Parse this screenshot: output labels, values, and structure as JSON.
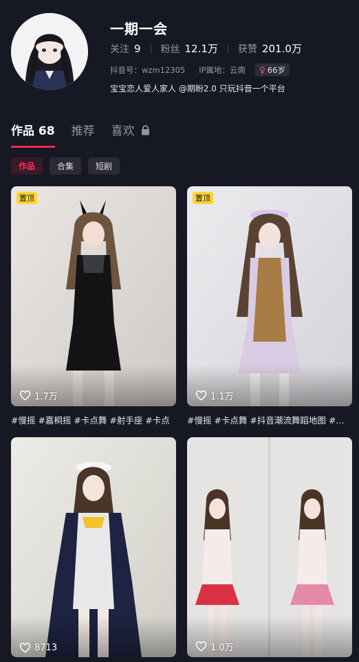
{
  "profile": {
    "name": "一期一会",
    "stats": [
      {
        "label": "关注",
        "value": "9"
      },
      {
        "label": "粉丝",
        "value": "12.1万"
      },
      {
        "label": "获赞",
        "value": "201.0万"
      }
    ],
    "douyin_id": "抖音号：wzm12305",
    "ip_location": "IP属地：云南",
    "age": "66岁",
    "bio": "宝宝恋人爱人家人 @期盼2.0 只玩抖音一个平台"
  },
  "tabs": [
    {
      "label": "作品",
      "count": "68"
    },
    {
      "label": "推荐"
    },
    {
      "label": "喜欢"
    }
  ],
  "chips": [
    "作品",
    "合集",
    "短剧"
  ],
  "videos": [
    {
      "pinned_label": "置顶",
      "likes": "1.7万",
      "caption": "#慢摇 #嘉桐摇 #卡点舞 #射手座 #卡点"
    },
    {
      "pinned_label": "置顶",
      "likes": "1.1万",
      "caption": "#慢摇 #卡点舞 #抖音潮流舞蹈地图 #慢摇"
    },
    {
      "likes": "8713"
    },
    {
      "likes": "1.0万"
    }
  ],
  "colors": {
    "background": "#161823",
    "accent": "#fe2c55",
    "pin_badge": "#fcd535"
  }
}
